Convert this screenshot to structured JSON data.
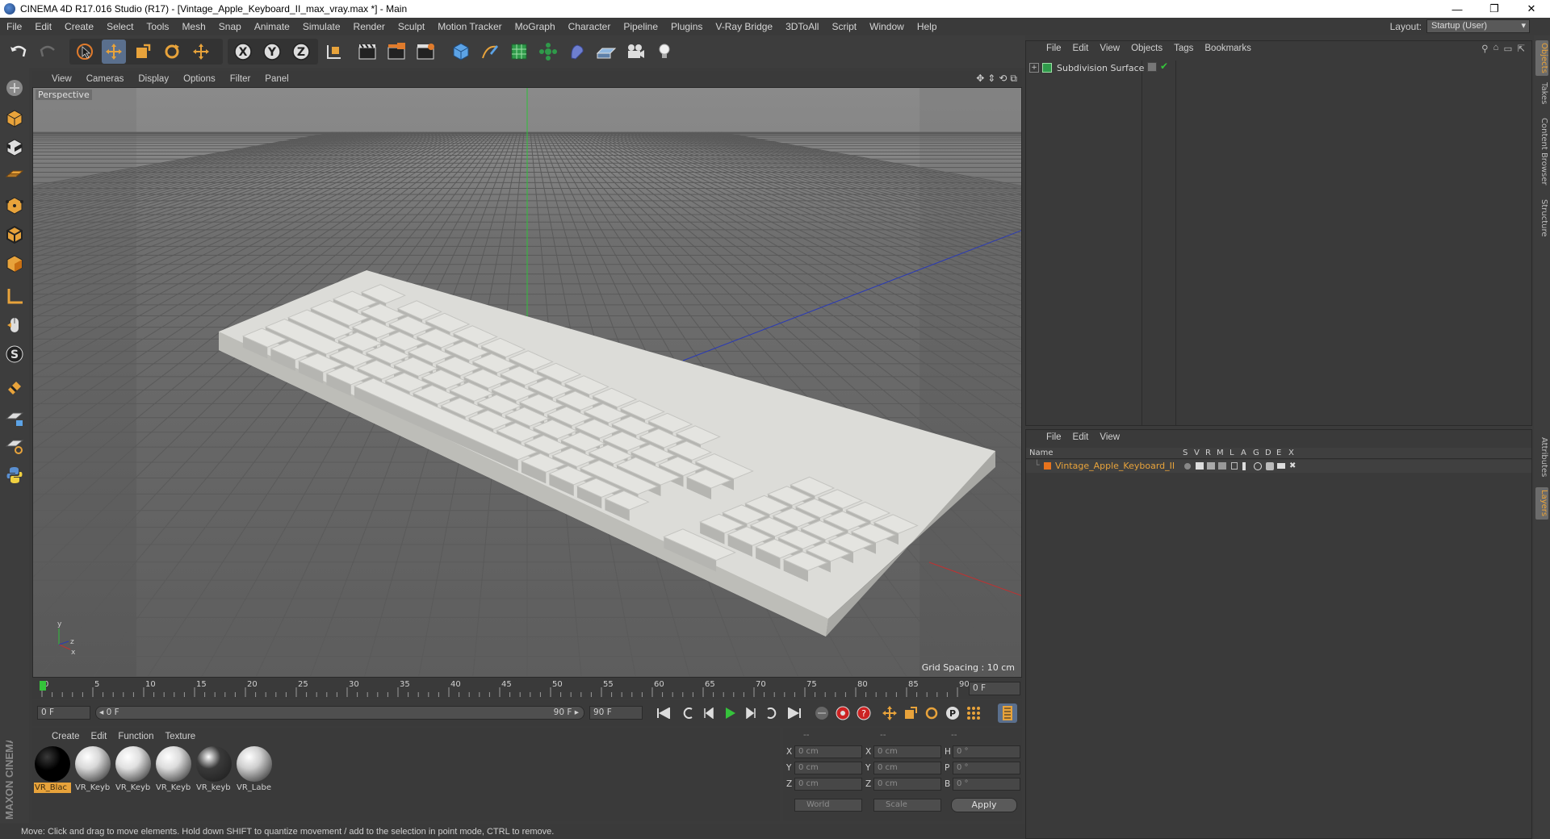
{
  "window": {
    "title": "CINEMA 4D R17.016 Studio (R17) - [Vintage_Apple_Keyboard_II_max_vray.max *] - Main",
    "controls": [
      "—",
      "❐",
      "✕"
    ]
  },
  "menubar": {
    "items": [
      "File",
      "Edit",
      "Create",
      "Select",
      "Tools",
      "Mesh",
      "Snap",
      "Animate",
      "Simulate",
      "Render",
      "Sculpt",
      "Motion Tracker",
      "MoGraph",
      "Character",
      "Pipeline",
      "Plugins",
      "V-Ray Bridge",
      "3DToAll",
      "Script",
      "Window",
      "Help"
    ],
    "layout_label": "Layout:",
    "layout_value": "Startup (User)"
  },
  "viewport": {
    "menu": [
      "View",
      "Cameras",
      "Display",
      "Options",
      "Filter",
      "Panel"
    ],
    "label": "Perspective",
    "grid_spacing": "Grid Spacing : 10 cm",
    "axis_labels": {
      "y": "y",
      "x": "x",
      "z": "z"
    }
  },
  "timeline": {
    "ticks": [
      "0",
      "5",
      "10",
      "15",
      "20",
      "25",
      "30",
      "35",
      "40",
      "45",
      "50",
      "55",
      "60",
      "65",
      "70",
      "75",
      "80",
      "85",
      "90"
    ],
    "current_frame": "0 F"
  },
  "transport": {
    "start_field": "0 F",
    "range_start": "◂ 0 F",
    "range_end": "90 F ▸",
    "end_field": "90 F"
  },
  "materials": {
    "menu": [
      "Create",
      "Edit",
      "Function",
      "Texture"
    ],
    "items": [
      {
        "name": "VR_Blac",
        "color": "#000000",
        "selected": true
      },
      {
        "name": "VR_Keyb",
        "color": "#d8d8d8",
        "selected": false
      },
      {
        "name": "VR_Keyb",
        "color": "#e0e0e0",
        "selected": false
      },
      {
        "name": "VR_Keyb",
        "color": "#dcdcdc",
        "selected": false
      },
      {
        "name": "VR_keyb",
        "color": "#3a3a3a",
        "selected": false
      },
      {
        "name": "VR_Labe",
        "color": "#cfcfcf",
        "selected": false
      }
    ]
  },
  "coords": {
    "header": [
      "--",
      "--",
      "--"
    ],
    "rows": [
      {
        "a": "X",
        "av": "0 cm",
        "b": "X",
        "bv": "0 cm",
        "c": "H",
        "cv": "0 °"
      },
      {
        "a": "Y",
        "av": "0 cm",
        "b": "Y",
        "bv": "0 cm",
        "c": "P",
        "cv": "0 °"
      },
      {
        "a": "Z",
        "av": "0 cm",
        "b": "Z",
        "bv": "0 cm",
        "c": "B",
        "cv": "0 °"
      }
    ],
    "mode1": "World",
    "mode2": "Scale",
    "apply": "Apply"
  },
  "status": "Move: Click and drag to move elements. Hold down SHIFT to quantize movement / add to the selection in point mode, CTRL to remove.",
  "objects_panel": {
    "menu": [
      "File",
      "Edit",
      "View",
      "Objects",
      "Tags",
      "Bookmarks"
    ],
    "rows": [
      {
        "name": "Subdivision Surface"
      }
    ]
  },
  "layers_panel": {
    "menu": [
      "File",
      "Edit",
      "View"
    ],
    "headers": [
      "Name",
      "S",
      "V",
      "R",
      "M",
      "L",
      "A",
      "G",
      "D",
      "E",
      "X"
    ],
    "rows": [
      {
        "name": "Vintage_Apple_Keyboard_II",
        "color": "#e8731c"
      }
    ]
  },
  "right_tabs": [
    "Objects",
    "Takes",
    "Content Browser",
    "Structure",
    "Attributes",
    "Layers"
  ],
  "brand": {
    "logo_text": "MAXON CINEMA 4D"
  },
  "colors": {
    "accent_orange": "#e8a33b",
    "active_blue": "#5a6f8d",
    "play_green": "#35c33b"
  }
}
